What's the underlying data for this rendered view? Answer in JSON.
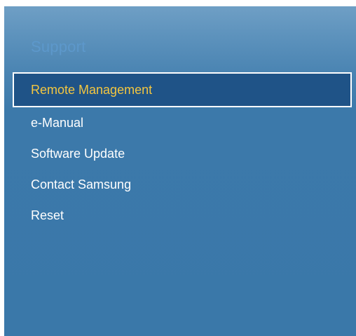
{
  "menu": {
    "title": "Support",
    "selected_index": 0,
    "items": [
      {
        "label": "Remote Management"
      },
      {
        "label": "e-Manual"
      },
      {
        "label": "Software Update"
      },
      {
        "label": "Contact Samsung"
      },
      {
        "label": "Reset"
      }
    ]
  },
  "colors": {
    "panel_top": "#6f9fc5",
    "panel_bottom": "#3a78a9",
    "title_text": "#5d98cb",
    "selected_background": "#1f5387",
    "selected_text": "#f3c640",
    "item_text": "#ffffff"
  }
}
